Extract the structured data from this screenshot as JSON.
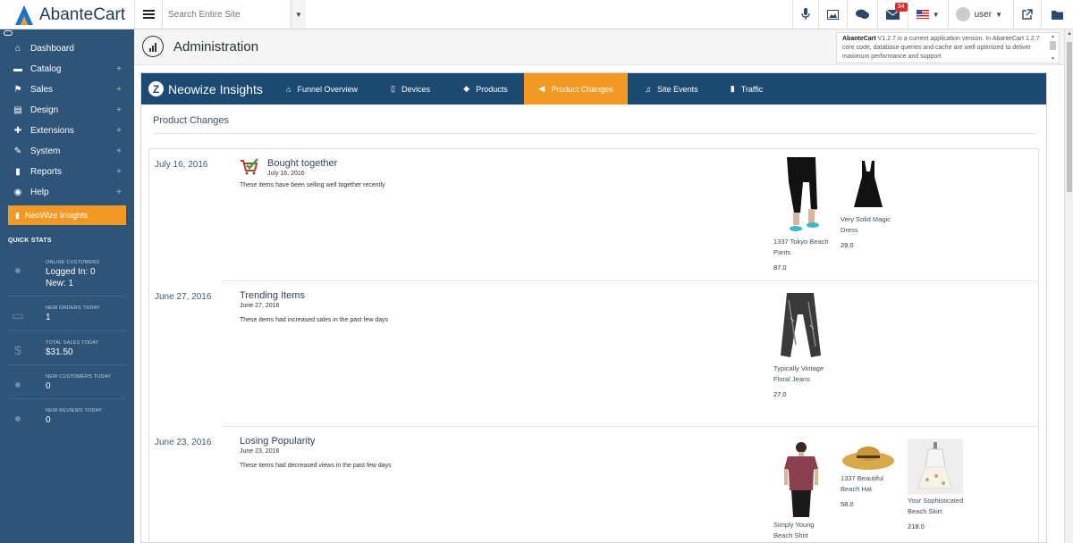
{
  "app": {
    "logo_text": "AbanteCart",
    "search_placeholder": "Search Entire Site",
    "notification_count": "34",
    "user_label": "user"
  },
  "sidebar": {
    "items": [
      {
        "label": "Dashboard",
        "icon": "home-icon",
        "has_plus": false
      },
      {
        "label": "Catalog",
        "icon": "folder-icon",
        "has_plus": true
      },
      {
        "label": "Sales",
        "icon": "flag-icon",
        "has_plus": true
      },
      {
        "label": "Design",
        "icon": "file-icon",
        "has_plus": true
      },
      {
        "label": "Extensions",
        "icon": "puzzle-icon",
        "has_plus": true
      },
      {
        "label": "System",
        "icon": "wrench-icon",
        "has_plus": true
      },
      {
        "label": "Reports",
        "icon": "bar-chart-icon",
        "has_plus": true
      },
      {
        "label": "Help",
        "icon": "globe-icon",
        "has_plus": true
      }
    ],
    "active_item": "NeoWize Insights",
    "quick_stats_title": "QUICK STATS",
    "quick_stats": [
      {
        "label": "ONLINE CUSTOMERS",
        "lines": [
          "Logged In: 0",
          "New: 1"
        ],
        "icon": "users-icon"
      },
      {
        "label": "NEW ORDERS TODAY",
        "lines": [
          "1"
        ],
        "icon": "credit-card-icon"
      },
      {
        "label": "TOTAL SALES TODAY",
        "lines": [
          "$31.50"
        ],
        "icon": "money-icon"
      },
      {
        "label": "NEW CUSTOMERS TODAY",
        "lines": [
          "0"
        ],
        "icon": "user-icon"
      },
      {
        "label": "NEW REVIEWS TODAY",
        "lines": [
          "0"
        ],
        "icon": "comment-icon"
      }
    ],
    "accent_color": "#f29924",
    "bg_color": "#2e5478"
  },
  "header": {
    "title": "Administration",
    "version_name": "AbanteCart",
    "version_text": " V1.2.7 is a current application version. In AbanteCart 1.2.7 core code, database queries and cache are well optimized to deliver maximum performance and support"
  },
  "panel": {
    "brand": "Neowize Insights",
    "tabs": [
      {
        "label": "Funnel Overview",
        "icon": "home-icon",
        "active": false
      },
      {
        "label": "Devices",
        "icon": "tablet-icon",
        "active": false
      },
      {
        "label": "Products",
        "icon": "cube-icon",
        "active": false
      },
      {
        "label": "Product Changes",
        "icon": "bullhorn-icon",
        "active": true
      },
      {
        "label": "Site Events",
        "icon": "bell-icon",
        "active": false
      },
      {
        "label": "Traffic",
        "icon": "bar-chart-icon",
        "active": false
      }
    ],
    "section_title": "Product Changes",
    "nav_color": "#1d4a73"
  },
  "events": [
    {
      "date": "July 16, 2016",
      "title": "Bought together",
      "subdate": "July 16, 2016",
      "desc": "These items have been selling well together recently",
      "products": [
        {
          "name": "1337 Tokyo Beach Pants",
          "price": "87.0",
          "image": "black-pants"
        },
        {
          "name": "Very Solid Magic Dress",
          "price": "29.0",
          "image": "black-dress"
        }
      ]
    },
    {
      "date": "June 27, 2016",
      "title": "Trending Items",
      "subdate": "June 27, 2016",
      "desc": "These items had increased sales in the past few days",
      "products": [
        {
          "name": "Typically Vintage Floral Jeans",
          "price": "27.0",
          "image": "jeans"
        }
      ]
    },
    {
      "date": "June 23, 2016",
      "title": "Losing Popularity",
      "subdate": "June 23, 2016",
      "desc": "These items had decreased views in the past few days",
      "products": [
        {
          "name": "Simply Young Beach Shirt",
          "price": "",
          "image": "shirt"
        },
        {
          "name": "1337 Beautiful Beach Hat",
          "price": "58.0",
          "image": "hat"
        },
        {
          "name": "Your Sophisticated Beach Skirt",
          "price": "218.0",
          "image": "skirt"
        }
      ]
    }
  ]
}
